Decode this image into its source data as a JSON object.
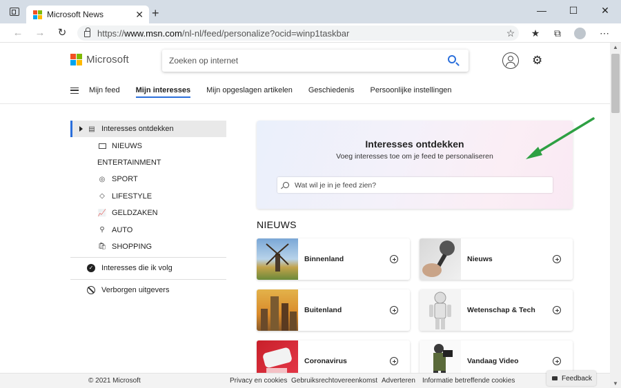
{
  "browser": {
    "tab_title": "Microsoft News",
    "url_prefix": "https://",
    "url_host": "www.msn.com",
    "url_path": "/nl-nl/feed/personalize?ocid=winp1taskbar"
  },
  "header": {
    "brand": "Microsoft",
    "search_placeholder": "Zoeken op internet"
  },
  "nav": {
    "items": [
      "Mijn feed",
      "Mijn interesses",
      "Mijn opgeslagen artikelen",
      "Geschiedenis",
      "Persoonlijke instellingen"
    ],
    "active": "Mijn interesses"
  },
  "sidebar": {
    "discover": "Interesses ontdekken",
    "categories": [
      "NIEUWS",
      "ENTERTAINMENT",
      "SPORT",
      "LIFESTYLE",
      "GELDZAKEN",
      "AUTO",
      "SHOPPING"
    ],
    "following": "Interesses die ik volg",
    "hidden": "Verborgen uitgevers"
  },
  "discover": {
    "title": "Interesses ontdekken",
    "subtitle": "Voeg interesses toe om je feed te personaliseren",
    "search_placeholder": "Wat wil je in je feed zien?"
  },
  "section": {
    "title": "NIEUWS",
    "cards": [
      "Binnenland",
      "Nieuws",
      "Buitenland",
      "Wetenschap & Tech",
      "Coronavirus",
      "Vandaag Video"
    ]
  },
  "footer": {
    "copyright": "© 2021 Microsoft",
    "links": [
      "Privacy en cookies",
      "Gebruiksrechtovereenkomst",
      "Adverteren",
      "Informatie betreffende cookies"
    ],
    "feedback": "Feedback"
  },
  "colors": {
    "accent": "#2a6fdb",
    "arrow": "#2ea043",
    "ms_red": "#f25022",
    "ms_green": "#7fba00",
    "ms_blue": "#00a4ef",
    "ms_yellow": "#ffb900"
  }
}
